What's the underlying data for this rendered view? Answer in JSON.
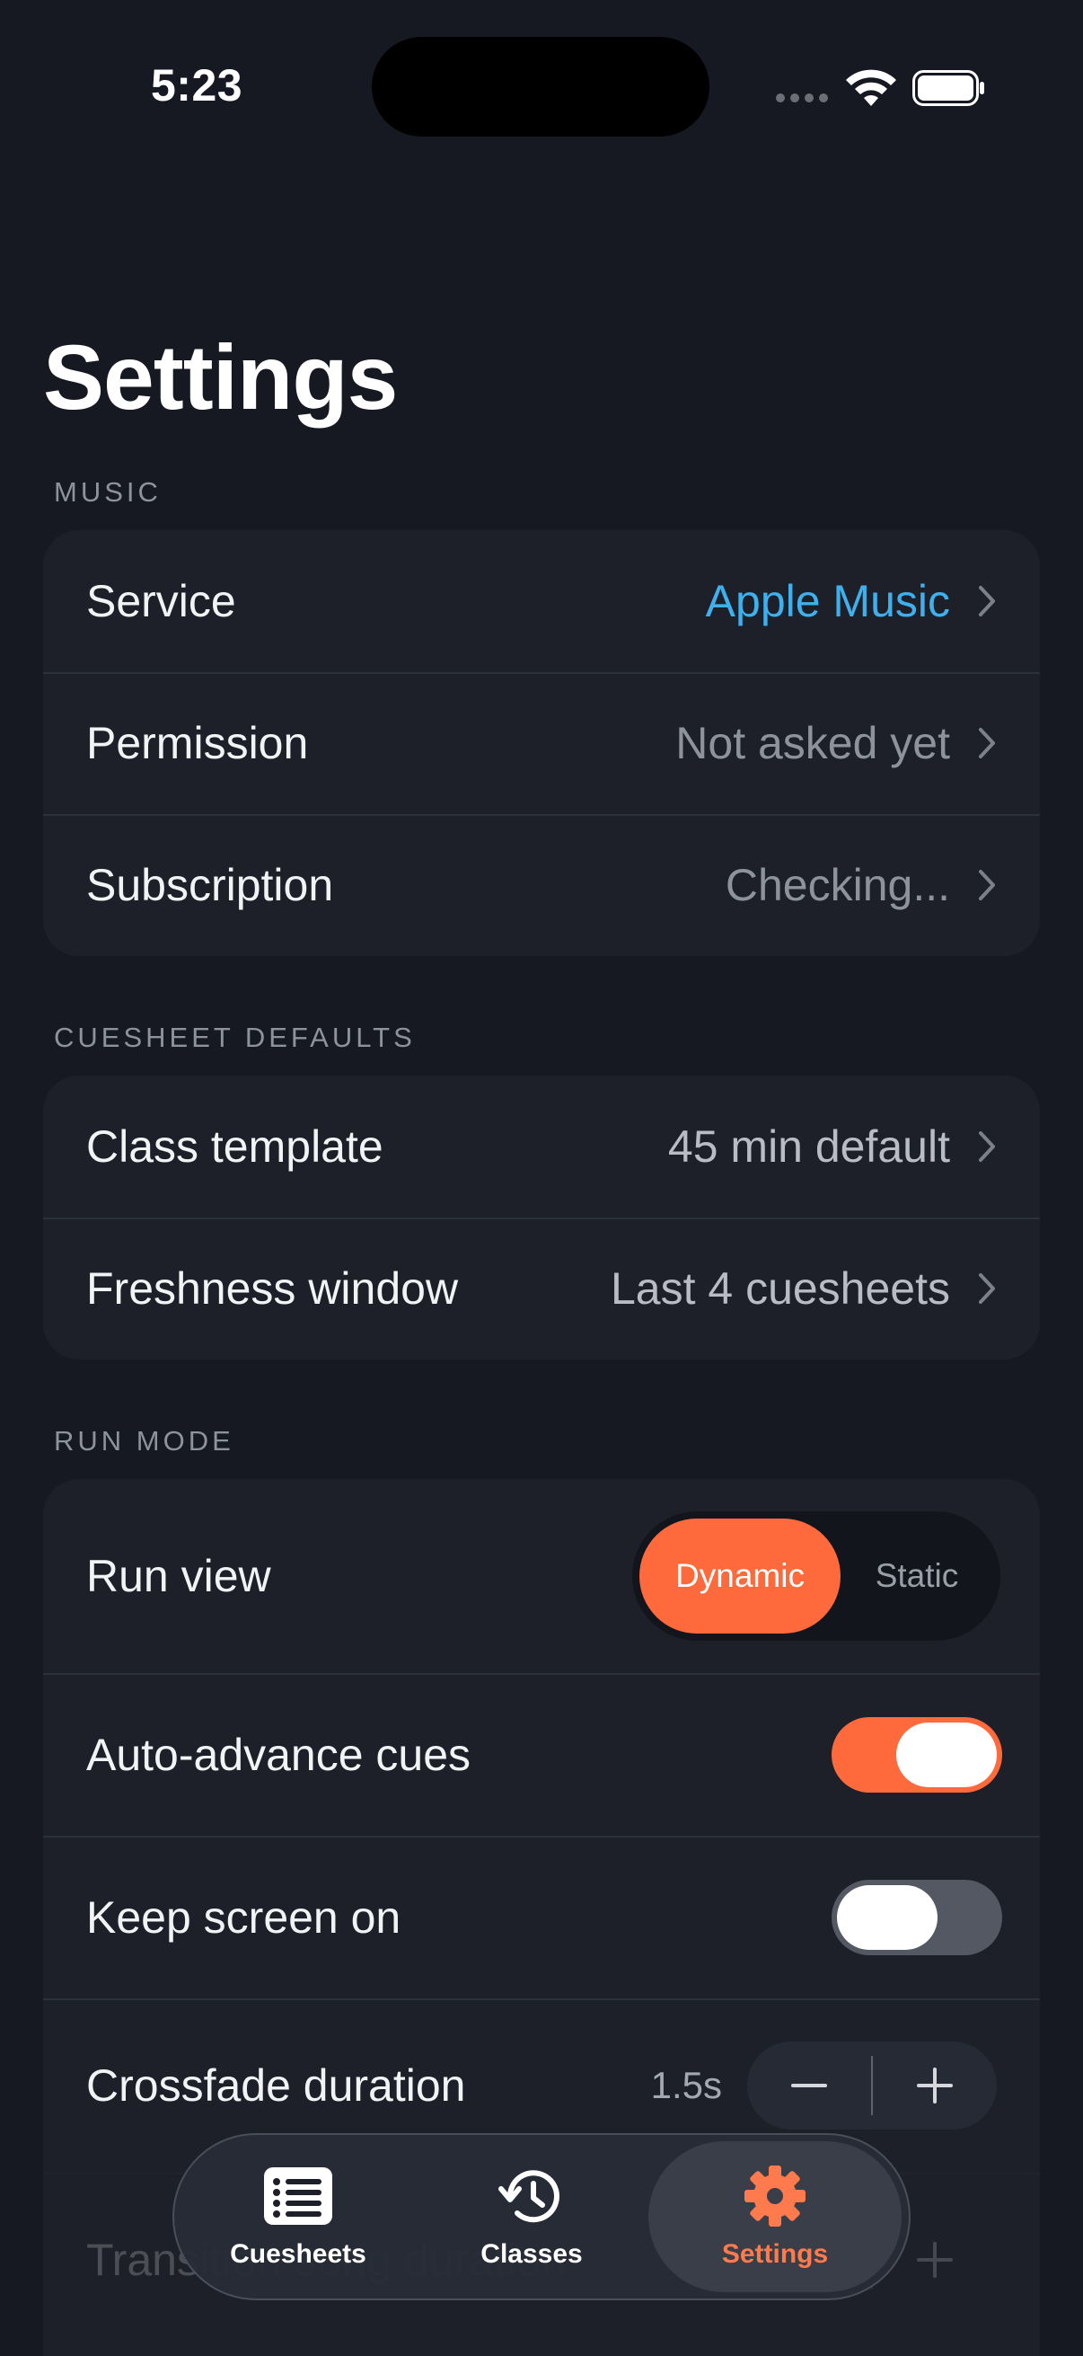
{
  "status_bar": {
    "time": "5:23"
  },
  "title": "Settings",
  "sections": {
    "music": {
      "header": "MUSIC",
      "rows": [
        {
          "label": "Service",
          "value": "Apple Music"
        },
        {
          "label": "Permission",
          "value": "Not asked yet"
        },
        {
          "label": "Subscription",
          "value": "Checking..."
        }
      ]
    },
    "cuesheet_defaults": {
      "header": "CUESHEET DEFAULTS",
      "rows": [
        {
          "label": "Class template",
          "value": "45 min default"
        },
        {
          "label": "Freshness window",
          "value": "Last 4 cuesheets"
        }
      ]
    },
    "run_mode": {
      "header": "RUN MODE",
      "run_view": {
        "label": "Run view",
        "options": [
          "Dynamic",
          "Static"
        ],
        "selected": "Dynamic"
      },
      "auto_advance": {
        "label": "Auto-advance cues",
        "on": true
      },
      "keep_screen_on": {
        "label": "Keep screen on",
        "on": false
      },
      "crossfade": {
        "label": "Crossfade duration",
        "value": "1.5s"
      },
      "transition": {
        "label": "Transition song duration"
      }
    }
  },
  "tab_bar": {
    "tabs": [
      {
        "label": "Cuesheets",
        "icon": "list-icon"
      },
      {
        "label": "Classes",
        "icon": "history-icon"
      },
      {
        "label": "Settings",
        "icon": "gear-icon",
        "active": true
      }
    ]
  },
  "colors": {
    "accent": "#ff6a3d",
    "link": "#3fb0ee",
    "background": "#161921",
    "card": "#1d2029"
  }
}
